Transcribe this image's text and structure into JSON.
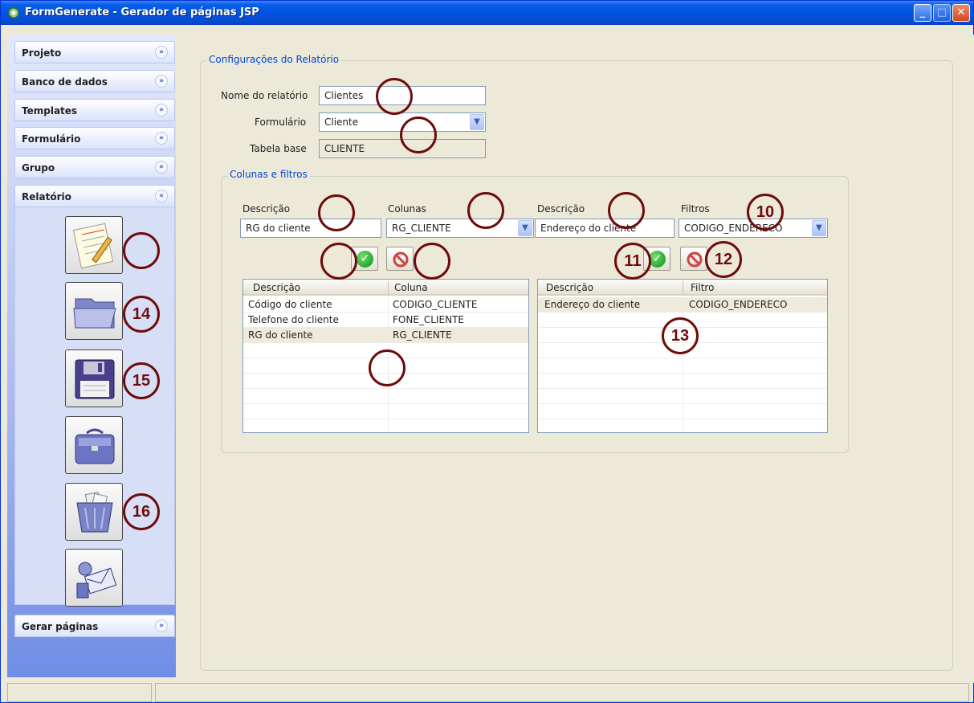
{
  "window": {
    "title": "FormGenerate - Gerador de páginas JSP"
  },
  "sidebar": {
    "panels": [
      {
        "label": "Projeto",
        "chevron": "»"
      },
      {
        "label": "Banco de dados",
        "chevron": "»"
      },
      {
        "label": "Templates",
        "chevron": "»"
      },
      {
        "label": "Formulário",
        "chevron": "»"
      },
      {
        "label": "Grupo",
        "chevron": "»"
      },
      {
        "label": "Relatório",
        "chevron": "«"
      },
      {
        "label": "Gerar páginas",
        "chevron": "»"
      }
    ],
    "buttons": [
      {
        "icon": "notepad-icon"
      },
      {
        "icon": "folder-open-icon"
      },
      {
        "icon": "floppy-save-icon"
      },
      {
        "icon": "briefcase-icon"
      },
      {
        "icon": "trash-icon"
      },
      {
        "icon": "envelope-send-icon"
      }
    ]
  },
  "report": {
    "legend": "Configurações do Relatório",
    "name_label": "Nome do relatório",
    "name_value": "Clientes",
    "form_label": "Formulário",
    "form_value": "Cliente",
    "table_label": "Tabela base",
    "table_value": "CLIENTE"
  },
  "columns_filters": {
    "legend": "Colunas e filtros",
    "left": {
      "desc_label": "Descrição",
      "desc_value": "RG do cliente",
      "col_label": "Colunas",
      "col_value": "RG_CLIENTE",
      "headers": [
        "Descrição",
        "Coluna"
      ],
      "rows": [
        [
          "Código do cliente",
          "CODIGO_CLIENTE"
        ],
        [
          "Telefone do cliente",
          "FONE_CLIENTE"
        ],
        [
          "RG do cliente",
          "RG_CLIENTE"
        ]
      ]
    },
    "right": {
      "desc_label": "Descrição",
      "desc_value": "Endereço do cliente",
      "filter_label": "Filtros",
      "filter_value": "CODIGO_ENDERECO",
      "headers": [
        "Descrição",
        "Filtro"
      ],
      "rows": [
        [
          "Endereço do cliente",
          "CODIGO_ENDERECO"
        ]
      ]
    }
  },
  "annotations": {
    "a10": "10",
    "a11": "11",
    "a12": "12",
    "a13": "13",
    "a14": "14",
    "a15": "15",
    "a16": "16"
  },
  "colors": {
    "annotation": "#6e0b0b",
    "titlebar": "#0054e3",
    "legend_text": "#0046d5"
  }
}
